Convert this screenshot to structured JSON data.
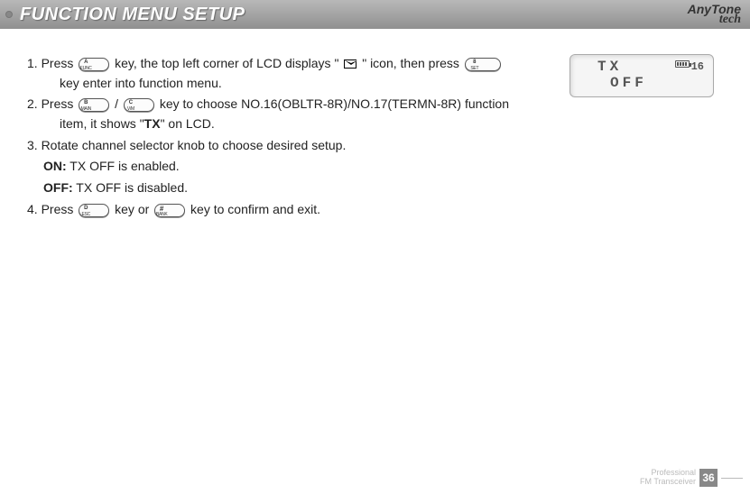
{
  "header": {
    "title": "FUNCTION MENU SETUP",
    "brand_main": "AnyTone",
    "brand_sub": "tech"
  },
  "lcd": {
    "line1": "TX",
    "line2": "OFF",
    "num": "16"
  },
  "steps": {
    "s1a": "1. Press ",
    "s1b": " key, the top left corner of LCD displays \" ",
    "s1c": " \" icon, then press ",
    "s1d": "key enter into function menu.",
    "s2a": "2. Press ",
    "s2b": " / ",
    "s2c": " key to choose NO.16(OBLTR-8R)/NO.17(TERMN-8R) function",
    "s2d": "item, it shows \"",
    "s2tx": "TX",
    "s2e": "\" on LCD.",
    "s3": "3. Rotate channel selector knob to choose desired setup.",
    "s3on_label": "ON:",
    "s3on_text": " TX OFF is enabled.",
    "s3off_label": "OFF:",
    "s3off_text": " TX OFF is disabled.",
    "s4a": "4. Press ",
    "s4b": " key or ",
    "s4c": " key to confirm and exit."
  },
  "keys": {
    "a_top": "A",
    "a_bot": "FUNC",
    "b_top": "B",
    "b_bot": "MAIN",
    "c_top": "C",
    "c_bot": "V/M",
    "d_top": "D",
    "d_bot": "ESC",
    "set_top": "8",
    "set_bot": "SET",
    "hash_top": "#",
    "hash_bot": "BANK"
  },
  "footer": {
    "line1": "Professional",
    "line2": "FM Transceiver",
    "page": "36"
  }
}
